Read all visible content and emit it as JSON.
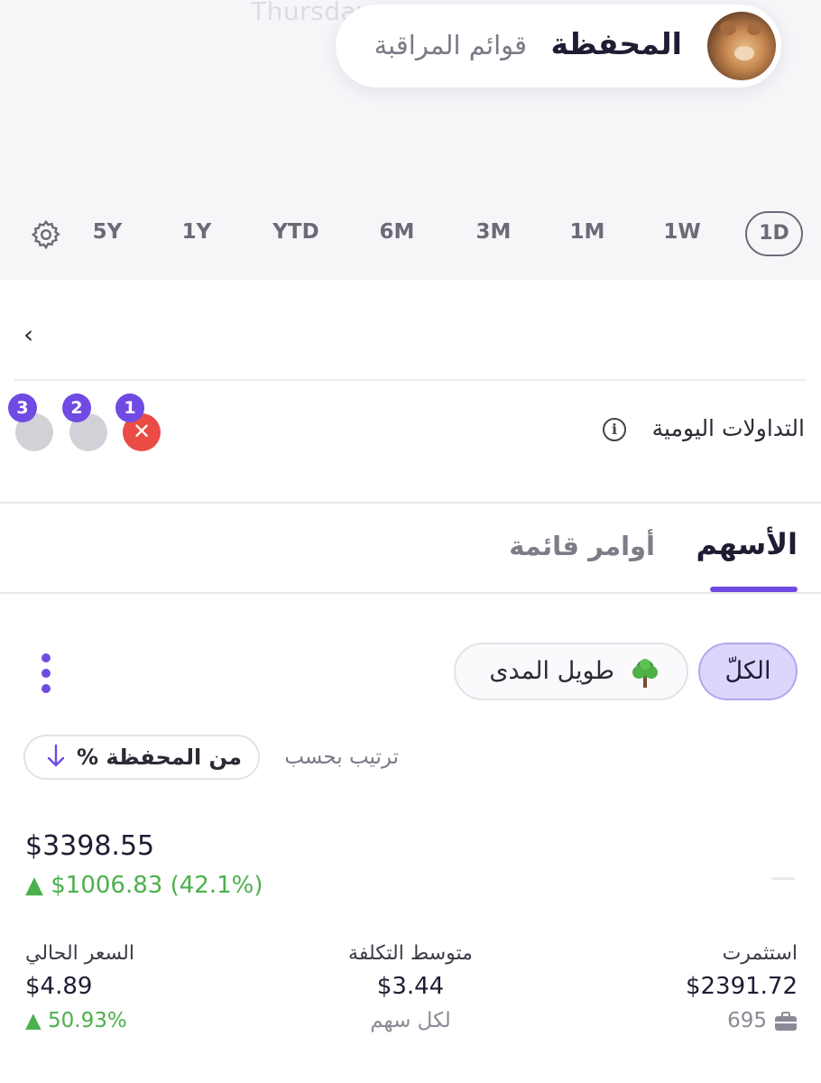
{
  "background_date_text": "Thursday",
  "header": {
    "tabs": [
      {
        "label": "المحفظة",
        "active": true
      },
      {
        "label": "قوائم المراقبة",
        "active": false
      }
    ]
  },
  "time_ranges": {
    "options": [
      "1D",
      "1W",
      "1M",
      "3M",
      "6M",
      "YTD",
      "1Y",
      "5Y"
    ],
    "selected": "1D",
    "settings_icon": "gear-icon"
  },
  "day_trades": {
    "label": "التداولات اليومية",
    "info_icon": "info-icon",
    "slots": [
      {
        "number": "1",
        "used": true,
        "mark": "✕"
      },
      {
        "number": "2",
        "used": false
      },
      {
        "number": "3",
        "used": false
      }
    ]
  },
  "section_tabs": {
    "tabs": [
      {
        "label": "الأسهم",
        "active": true
      },
      {
        "label": "أوامر قائمة",
        "active": false
      }
    ]
  },
  "filters": {
    "chips": [
      {
        "label": "الكلّ",
        "selected": true
      },
      {
        "label": "طويل المدى",
        "selected": false,
        "icon": "tree-icon"
      }
    ]
  },
  "sort": {
    "label": "ترتيب بحسب",
    "value": "% من المحفظة",
    "direction_icon": "arrow-down-icon"
  },
  "holding": {
    "total_value": "$3398.55",
    "gain": "▲ $1006.83 (42.1%)",
    "invested": {
      "label": "استثمرت",
      "value": "$2391.72",
      "shares": "695"
    },
    "avg_cost": {
      "label": "متوسط التكلفة",
      "value": "$3.44",
      "sub": "لكل سهم"
    },
    "current_price": {
      "label": "السعر الحالي",
      "value": "$4.89",
      "change": "▲ 50.93%"
    }
  },
  "colors": {
    "accent": "#6f4be3",
    "positive": "#4cb04c",
    "negative": "#ea4b45",
    "chip_selected_bg": "#ddd5fb"
  }
}
